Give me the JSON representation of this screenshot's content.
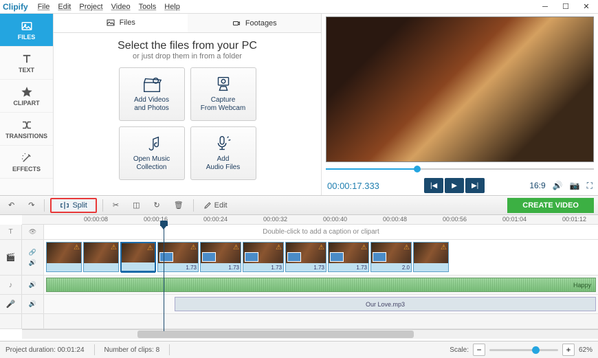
{
  "app": {
    "name": "Clipify"
  },
  "menu": [
    "File",
    "Edit",
    "Project",
    "Video",
    "Tools",
    "Help"
  ],
  "sidebar": [
    {
      "label": "FILES",
      "icon": "image-icon",
      "active": true
    },
    {
      "label": "TEXT",
      "icon": "text-icon"
    },
    {
      "label": "CLIPART",
      "icon": "star-icon"
    },
    {
      "label": "TRANSITIONS",
      "icon": "transitions-icon"
    },
    {
      "label": "EFFECTS",
      "icon": "wand-icon"
    }
  ],
  "files_panel": {
    "tabs": [
      {
        "label": "Files",
        "icon": "picture-icon",
        "active": true
      },
      {
        "label": "Footages",
        "icon": "camera-icon"
      }
    ],
    "heading": "Select the files from your PC",
    "subheading": "or just drop them in from a folder",
    "buttons": [
      {
        "line1": "Add Videos",
        "line2": "and Photos",
        "icon": "clapper-icon"
      },
      {
        "line1": "Capture",
        "line2": "From Webcam",
        "icon": "webcam-icon"
      },
      {
        "line1": "Open Music",
        "line2": "Collection",
        "icon": "music-icon"
      },
      {
        "line1": "Add",
        "line2": "Audio Files",
        "icon": "mic-icon"
      }
    ]
  },
  "preview": {
    "timecode": "00:00:17.333",
    "aspect": "16:9"
  },
  "toolbar": {
    "split": "Split",
    "edit": "Edit",
    "create": "CREATE VIDEO"
  },
  "timeline": {
    "ruler": [
      "00:00:08",
      "00:00:16",
      "00:00:24",
      "00:00:32",
      "00:00:40",
      "00:00:48",
      "00:00:56",
      "00:01:04",
      "00:01:12"
    ],
    "caption_hint": "Double-click to add a caption or clipart",
    "clips": [
      {
        "dur": ""
      },
      {
        "dur": ""
      },
      {
        "dur": "",
        "selected": true
      },
      {
        "dur": "1.73",
        "sub": true
      },
      {
        "dur": "1.73",
        "sub": true
      },
      {
        "dur": "1.73",
        "sub": true
      },
      {
        "dur": "1.73",
        "sub": true
      },
      {
        "dur": "1.73",
        "sub": true
      },
      {
        "dur": "2.0",
        "sub": true
      },
      {
        "dur": ""
      }
    ],
    "audio1_label": "Happy",
    "audio2_label": "Our Love.mp3"
  },
  "status": {
    "duration_label": "Project duration:",
    "duration": "00:01:24",
    "clips_label": "Number of clips:",
    "clips": "8",
    "scale_label": "Scale:",
    "zoom": "62%"
  }
}
